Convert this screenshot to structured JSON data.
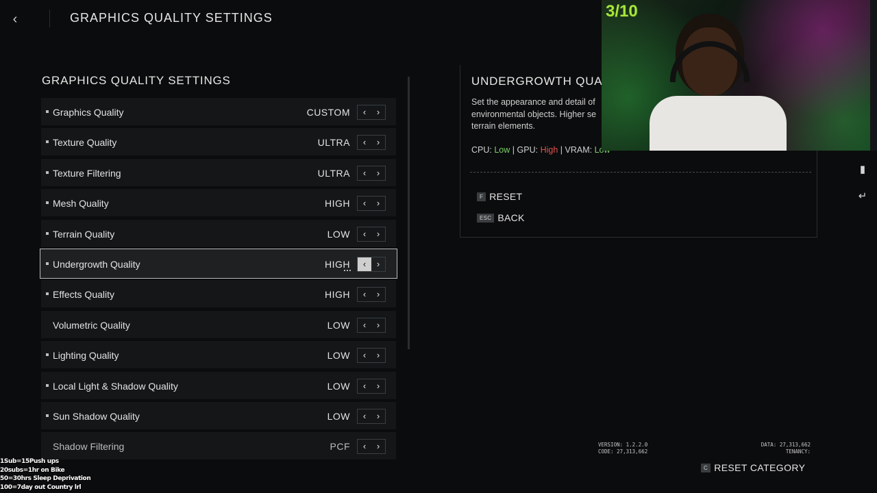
{
  "header": {
    "back_icon": "chevron-left-icon",
    "title": "GRAPHICS QUALITY SETTINGS"
  },
  "left_panel": {
    "title": "GRAPHICS QUALITY SETTINGS",
    "rows": [
      {
        "label": "Graphics Quality",
        "value": "CUSTOM"
      },
      {
        "label": "Texture Quality",
        "value": "ULTRA"
      },
      {
        "label": "Texture Filtering",
        "value": "ULTRA"
      },
      {
        "label": "Mesh Quality",
        "value": "HIGH"
      },
      {
        "label": "Terrain Quality",
        "value": "LOW"
      },
      {
        "label": "Undergrowth Quality",
        "value": "HIGH"
      },
      {
        "label": "Effects Quality",
        "value": "HIGH"
      },
      {
        "label": "Volumetric Quality",
        "value": "LOW"
      },
      {
        "label": "Lighting Quality",
        "value": "LOW"
      },
      {
        "label": "Local Light & Shadow Quality",
        "value": "LOW"
      },
      {
        "label": "Sun Shadow Quality",
        "value": "LOW"
      },
      {
        "label": "Shadow Filtering",
        "value": "PCF"
      }
    ],
    "selected_index": 5
  },
  "detail": {
    "title": "UNDERGROWTH QUAL",
    "description_line1": "Set the appearance and detail of",
    "description_line2": "environmental objects. Higher se",
    "description_line3": "terrain elements.",
    "cpu_label": "CPU:",
    "cpu_value": "Low",
    "gpu_label": "GPU:",
    "gpu_value": "High",
    "vram_label": "VRAM:",
    "vram_value": "Low",
    "separator": "|",
    "reset_key": "F",
    "reset_label": "RESET",
    "back_key": "ESC",
    "back_label": "BACK"
  },
  "webcam": {
    "counter": "3/10"
  },
  "footer": {
    "version": "VERSION: 1.2.2.0",
    "code": "CODE: 27,313,662",
    "data": "DATA: 27,313,662",
    "tenancy": "TENANCY:",
    "reset_category_key": "C",
    "reset_category_label": "RESET CATEGORY"
  },
  "stream_goals": [
    "1Sub=15Push ups",
    "20subs=1hr on Bike",
    "50=30hrs Sleep Deprivation",
    "100=7day out Country lrl"
  ],
  "colors": {
    "low": "#7bd06a",
    "high": "#e2524d",
    "counter": "#a8e63c"
  }
}
